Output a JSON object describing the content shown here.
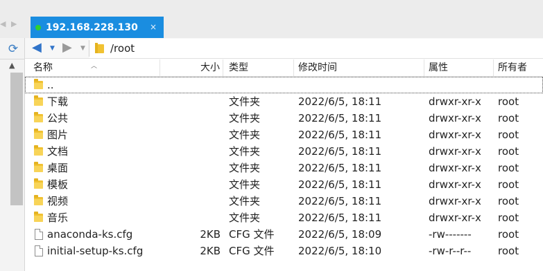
{
  "tab": {
    "title": "192.168.228.130",
    "close": "×",
    "status_color": "#2fd12f",
    "accent": "#1a8de0"
  },
  "toolbar": {
    "path": "/root"
  },
  "columns": {
    "name": "名称",
    "size": "大小",
    "type": "类型",
    "modified": "修改时间",
    "attributes": "属性",
    "owner": "所有者"
  },
  "files": [
    {
      "name": "..",
      "size": "",
      "type": "",
      "modified": "",
      "attributes": "",
      "owner": "",
      "icon": "folder-icon",
      "selected": true
    },
    {
      "name": "下载",
      "size": "",
      "type": "文件夹",
      "modified": "2022/6/5, 18:11",
      "attributes": "drwxr-xr-x",
      "owner": "root",
      "icon": "folder-icon"
    },
    {
      "name": "公共",
      "size": "",
      "type": "文件夹",
      "modified": "2022/6/5, 18:11",
      "attributes": "drwxr-xr-x",
      "owner": "root",
      "icon": "folder-icon"
    },
    {
      "name": "图片",
      "size": "",
      "type": "文件夹",
      "modified": "2022/6/5, 18:11",
      "attributes": "drwxr-xr-x",
      "owner": "root",
      "icon": "folder-icon"
    },
    {
      "name": "文档",
      "size": "",
      "type": "文件夹",
      "modified": "2022/6/5, 18:11",
      "attributes": "drwxr-xr-x",
      "owner": "root",
      "icon": "folder-icon"
    },
    {
      "name": "桌面",
      "size": "",
      "type": "文件夹",
      "modified": "2022/6/5, 18:11",
      "attributes": "drwxr-xr-x",
      "owner": "root",
      "icon": "folder-icon"
    },
    {
      "name": "模板",
      "size": "",
      "type": "文件夹",
      "modified": "2022/6/5, 18:11",
      "attributes": "drwxr-xr-x",
      "owner": "root",
      "icon": "folder-icon"
    },
    {
      "name": "视频",
      "size": "",
      "type": "文件夹",
      "modified": "2022/6/5, 18:11",
      "attributes": "drwxr-xr-x",
      "owner": "root",
      "icon": "folder-icon"
    },
    {
      "name": "音乐",
      "size": "",
      "type": "文件夹",
      "modified": "2022/6/5, 18:11",
      "attributes": "drwxr-xr-x",
      "owner": "root",
      "icon": "folder-icon"
    },
    {
      "name": "anaconda-ks.cfg",
      "size": "2KB",
      "type": "CFG 文件",
      "modified": "2022/6/5, 18:09",
      "attributes": "-rw-------",
      "owner": "root",
      "icon": "file-icon"
    },
    {
      "name": "initial-setup-ks.cfg",
      "size": "2KB",
      "type": "CFG 文件",
      "modified": "2022/6/5, 18:10",
      "attributes": "-rw-r--r--",
      "owner": "root",
      "icon": "file-icon"
    }
  ]
}
